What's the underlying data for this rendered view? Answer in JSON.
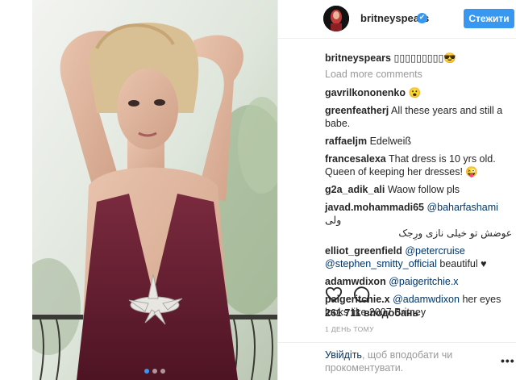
{
  "post": {
    "header": {
      "username": "britneyspears",
      "verified_mark": "✔",
      "follow_label": "Стежити"
    },
    "caption": {
      "user": "britneyspears",
      "text": "▯▯▯▯▯▯▯▯▯😎"
    },
    "load_more": "Load more comments",
    "comments": [
      {
        "user": "gavrilkononenko",
        "text": "😮"
      },
      {
        "user": "greenfeatherj",
        "text": "All these years and still a babe."
      },
      {
        "user": "raffaeljm",
        "text": "Edelweiß"
      },
      {
        "user": "francesalexa",
        "text": "That dress is 10 yrs old. Queen of keeping her dresses! 😜"
      },
      {
        "user": "g2a_adik_ali",
        "text": "Waow follow pls"
      },
      {
        "user": "javad.mohammadi65",
        "mention": "@baharfashami",
        "text": "ولی",
        "rtl_text": "عوضش تو خیلی نازی ورِجک"
      },
      {
        "user": "elliot_greenfield",
        "mention": "@petercruise",
        "mention2": "@stephen_smitty_official",
        "text": "beautiful ♥"
      },
      {
        "user": "adamwdixon",
        "mention": "@paigeritchie.x"
      },
      {
        "user": "paigeritchie.x",
        "mention": "@adamwdixon",
        "text": "her eyes looks like 2007 Britney"
      }
    ],
    "actions": {
      "like_icon": "heart-icon",
      "comment_icon": "comment-icon",
      "more_icon": "more-icon",
      "more_glyph": "•••"
    },
    "likes": "261 711 вподобань",
    "time": "1 день тому",
    "login": {
      "link": "Увійдіть",
      "text": ", щоб вподобати чи прокоментувати."
    },
    "carousel": {
      "count": 3,
      "active": 0
    },
    "colors": {
      "accent": "#3897f0",
      "link": "#003569",
      "muted": "#999999",
      "dress": "#6b1f33"
    }
  }
}
